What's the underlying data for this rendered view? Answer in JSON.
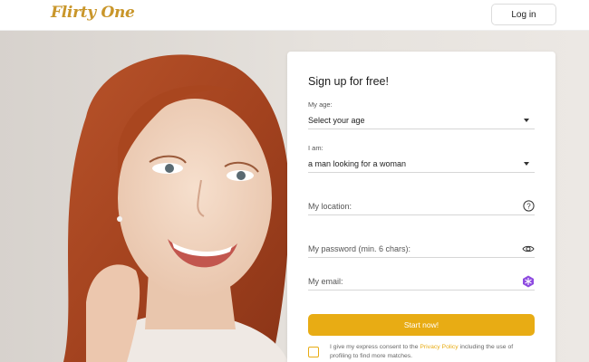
{
  "header": {
    "logo_text": "Flirty One",
    "login_label": "Log in"
  },
  "signup": {
    "title": "Sign up for free!",
    "age": {
      "label": "My age:",
      "value": "Select your age"
    },
    "iam": {
      "label": "I am:",
      "value": "a man looking for a woman"
    },
    "location": {
      "placeholder": "My location:"
    },
    "password": {
      "placeholder": "My password (min. 6 chars):"
    },
    "email": {
      "placeholder": "My email:"
    },
    "submit_label": "Start now!",
    "consent": {
      "before": "I give my express consent to the ",
      "link": "Privacy Policy",
      "after": " including the use of profiling to find more matches."
    }
  },
  "icons": {
    "age_caret": "chevron-down-icon",
    "iam_caret": "chevron-down-icon",
    "location": "help-circle-icon",
    "password": "eye-icon",
    "email": "password-manager-icon"
  },
  "colors": {
    "brand": "#c9962a",
    "accent": "#e8ac14",
    "manager_icon": "#8e4be0"
  }
}
